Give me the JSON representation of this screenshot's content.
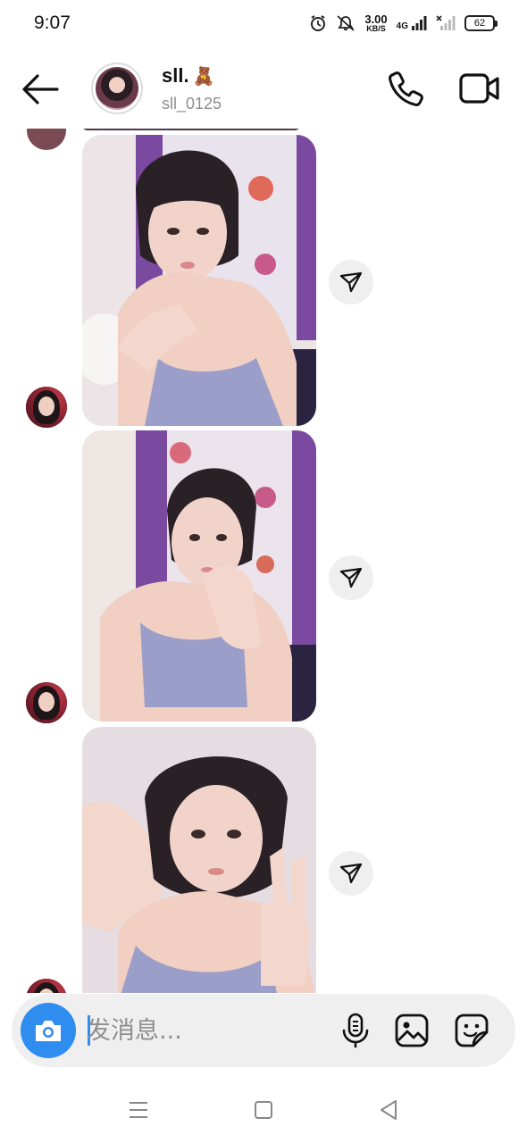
{
  "status_bar": {
    "time": "9:07",
    "net_speed_value": "3.00",
    "net_speed_unit": "KB/S",
    "network": "4G",
    "battery": "62"
  },
  "header": {
    "name": "sll.",
    "name_emoji": "🧸",
    "username": "sll_0125"
  },
  "thread": {
    "messages": [
      {
        "type": "photo",
        "shared_icon": "send-icon"
      },
      {
        "type": "photo",
        "shared_icon": "send-icon"
      },
      {
        "type": "photo",
        "shared_icon": "send-icon"
      }
    ]
  },
  "composer": {
    "placeholder": "发消息..."
  },
  "nav": {
    "items": [
      "menu-icon",
      "home-icon",
      "back-icon"
    ]
  },
  "colors": {
    "accent": "#2f8df0",
    "composer_bg": "#efefef",
    "secondary_text": "#8e8e8e"
  }
}
